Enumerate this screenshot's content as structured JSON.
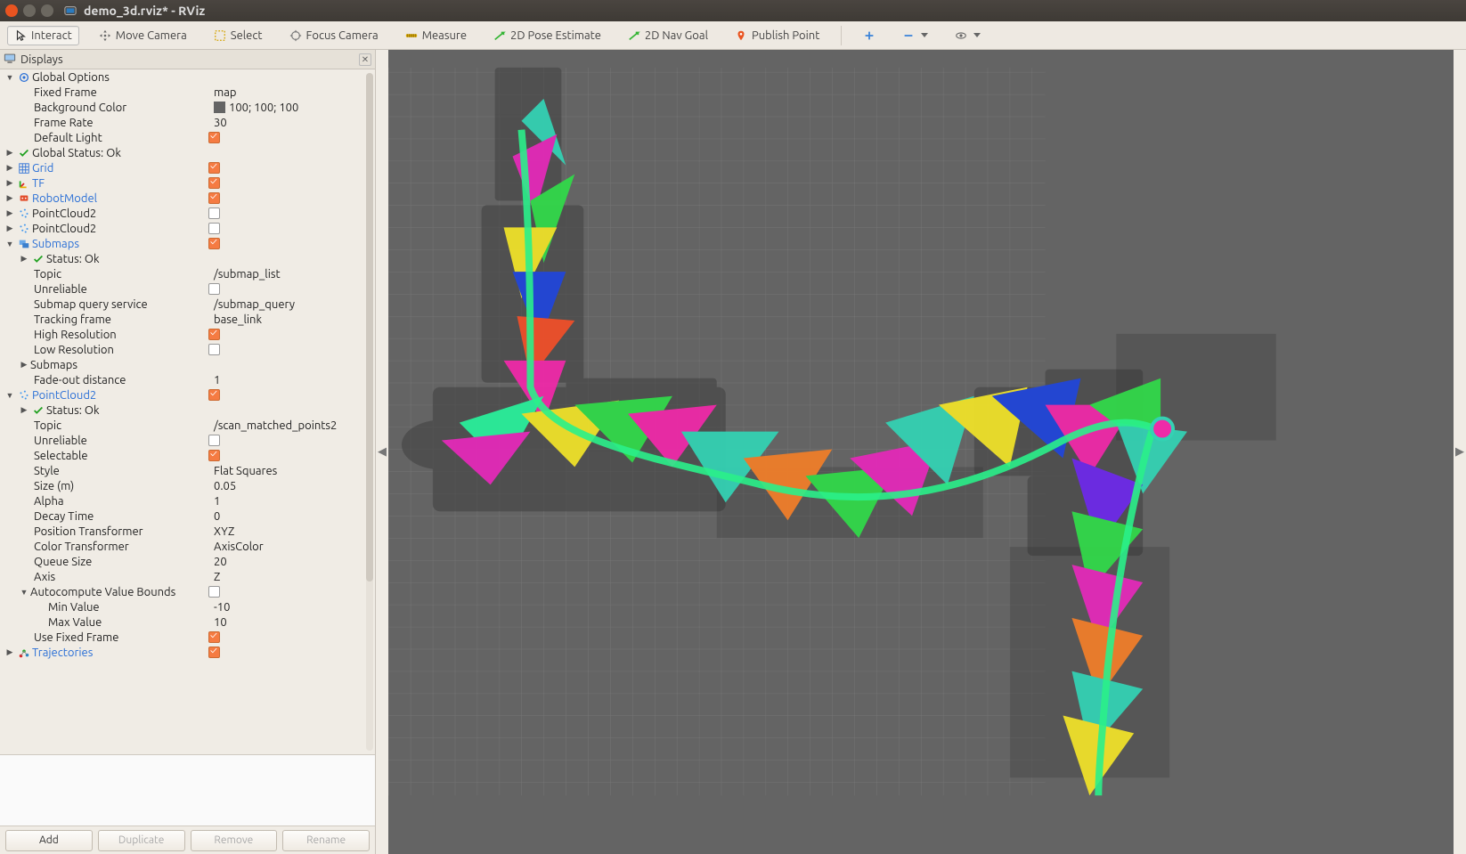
{
  "window": {
    "title": "demo_3d.rviz* - RViz"
  },
  "toolbar": {
    "interact": "Interact",
    "move_camera": "Move Camera",
    "select": "Select",
    "focus_camera": "Focus Camera",
    "measure": "Measure",
    "pose_estimate": "2D Pose Estimate",
    "nav_goal": "2D Nav Goal",
    "publish_point": "Publish Point"
  },
  "panel": {
    "title": "Displays",
    "footer": {
      "add": "Add",
      "duplicate": "Duplicate",
      "remove": "Remove",
      "rename": "Rename"
    }
  },
  "tree": {
    "global_options": {
      "label": "Global Options",
      "fixed_frame": {
        "label": "Fixed Frame",
        "value": "map"
      },
      "bg_color": {
        "label": "Background Color",
        "value": "100; 100; 100"
      },
      "frame_rate": {
        "label": "Frame Rate",
        "value": "30"
      },
      "default_light": {
        "label": "Default Light",
        "checked": true
      }
    },
    "global_status": {
      "label": "Global Status: Ok"
    },
    "grid": {
      "label": "Grid",
      "checked": true
    },
    "tf": {
      "label": "TF",
      "checked": true
    },
    "robot_model": {
      "label": "RobotModel",
      "checked": true
    },
    "pc2_a": {
      "label": "PointCloud2",
      "checked": false
    },
    "pc2_b": {
      "label": "PointCloud2",
      "checked": false
    },
    "submaps": {
      "label": "Submaps",
      "checked": true,
      "status": {
        "label": "Status: Ok"
      },
      "topic": {
        "label": "Topic",
        "value": "/submap_list"
      },
      "unreliable": {
        "label": "Unreliable",
        "checked": false
      },
      "query": {
        "label": "Submap query service",
        "value": "/submap_query"
      },
      "track": {
        "label": "Tracking frame",
        "value": "base_link"
      },
      "hires": {
        "label": "High Resolution",
        "checked": true
      },
      "lores": {
        "label": "Low Resolution",
        "checked": false
      },
      "submaps_child": {
        "label": "Submaps"
      },
      "fade": {
        "label": "Fade-out distance",
        "value": "1"
      }
    },
    "pc2_c": {
      "label": "PointCloud2",
      "checked": true,
      "status": {
        "label": "Status: Ok"
      },
      "topic": {
        "label": "Topic",
        "value": "/scan_matched_points2"
      },
      "unreliable": {
        "label": "Unreliable",
        "checked": false
      },
      "selectable": {
        "label": "Selectable",
        "checked": true
      },
      "style": {
        "label": "Style",
        "value": "Flat Squares"
      },
      "size": {
        "label": "Size (m)",
        "value": "0.05"
      },
      "alpha": {
        "label": "Alpha",
        "value": "1"
      },
      "decay": {
        "label": "Decay Time",
        "value": "0"
      },
      "pos_tr": {
        "label": "Position Transformer",
        "value": "XYZ"
      },
      "col_tr": {
        "label": "Color Transformer",
        "value": "AxisColor"
      },
      "queue": {
        "label": "Queue Size",
        "value": "20"
      },
      "axis": {
        "label": "Axis",
        "value": "Z"
      },
      "auto": {
        "label": "Autocompute Value Bounds",
        "checked": false,
        "min": {
          "label": "Min Value",
          "value": "-10"
        },
        "max": {
          "label": "Max Value",
          "value": "10"
        }
      },
      "use_fixed": {
        "label": "Use Fixed Frame",
        "checked": true
      }
    },
    "trajectories": {
      "label": "Trajectories",
      "checked": true
    }
  },
  "view": {
    "bg": "rgb(100,100,100)"
  }
}
